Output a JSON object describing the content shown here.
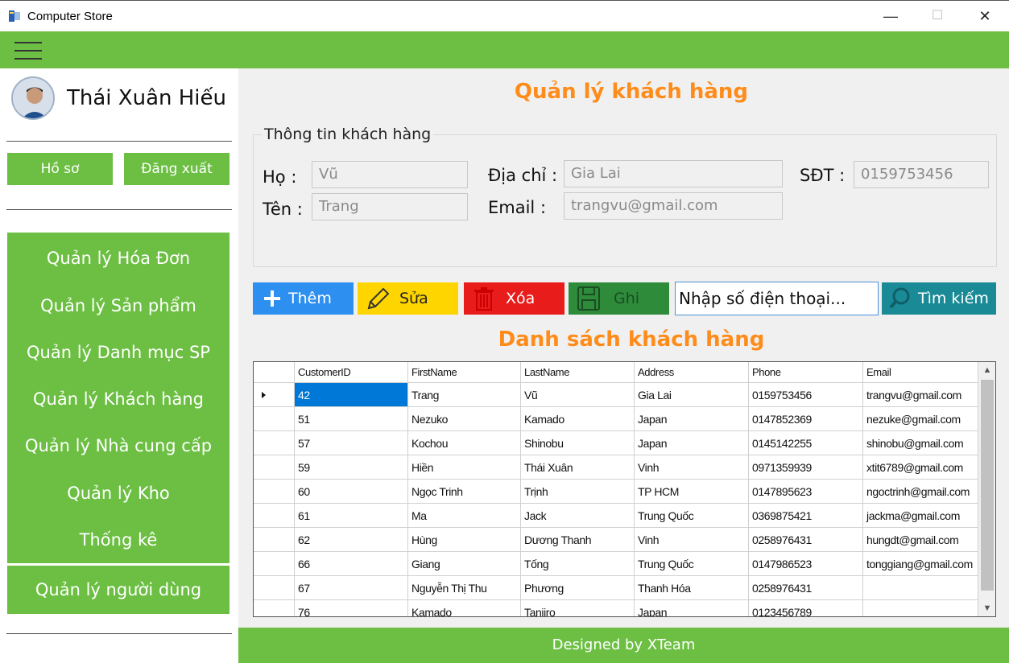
{
  "window": {
    "title": "Computer Store",
    "minimize": "—",
    "maximize": "☐",
    "close": "✕"
  },
  "sidebar": {
    "user_name": "Thái Xuân Hiếu",
    "profile_btn": "Hồ sơ",
    "logout_btn": "Đăng xuất",
    "nav": [
      "Quản lý Hóa Đơn",
      "Quản lý Sản phẩm",
      "Quản lý Danh mục SP",
      "Quản lý Khách hàng",
      "Quản lý Nhà cung cấp",
      "Quản lý Kho",
      "Thống kê"
    ],
    "user_mgmt": "Quản lý người dùng"
  },
  "main": {
    "title": "Quản lý khách hàng",
    "group_title": "Thông tin khách hàng",
    "labels": {
      "ho": "Họ :",
      "ten": "Tên :",
      "diachi": "Địa chỉ :",
      "email": "Email :",
      "sdt": "SĐT :"
    },
    "values": {
      "ho": "Vũ",
      "ten": "Trang",
      "diachi": "Gia Lai",
      "email": "trangvu@gmail.com",
      "sdt": "0159753456"
    },
    "buttons": {
      "add": "Thêm",
      "edit": "Sửa",
      "delete": "Xóa",
      "save": "Ghi",
      "search": "Tìm kiếm"
    },
    "search_value": "Nhập số điện thoại...",
    "list_title": "Danh sách khách hàng"
  },
  "colors": {
    "green": "#6cbf43",
    "orange": "#ff8c1a",
    "add": "#2d8ff0",
    "edit": "#ffd500",
    "delete": "#e91c1c",
    "save": "#2e8b3a",
    "search": "#1a8a96"
  },
  "grid": {
    "columns": [
      "CustomerID",
      "FirstName",
      "LastName",
      "Address",
      "Phone",
      "Email"
    ],
    "rows": [
      [
        "42",
        "Trang",
        "Vũ",
        "Gia Lai",
        "0159753456",
        "trangvu@gmail.com"
      ],
      [
        "51",
        "Nezuko",
        "Kamado",
        "Japan",
        "0147852369",
        "nezuke@gmail.com"
      ],
      [
        "57",
        "Kochou",
        "Shinobu",
        "Japan",
        "0145142255",
        "shinobu@gmail.com"
      ],
      [
        "59",
        "Hiền",
        "Thái Xuân",
        "Vinh",
        "0971359939",
        "xtit6789@gmail.com"
      ],
      [
        "60",
        "Ngọc Trinh",
        "Trịnh",
        "TP HCM",
        "0147895623",
        "ngoctrinh@gmail.com"
      ],
      [
        "61",
        "Ma",
        "Jack",
        "Trung Quốc",
        "0369875421",
        "jackma@gmail.com"
      ],
      [
        "62",
        "Hùng",
        "Dương Thanh",
        "Vinh",
        "0258976431",
        "hungdt@gmail.com"
      ],
      [
        "66",
        "Giang",
        "Tống",
        "Trung Quốc",
        "0147986523",
        "tonggiang@gmail.com"
      ],
      [
        "67",
        "Nguyễn Thị Thu",
        "Phương",
        "Thanh Hóa",
        "0258976431",
        ""
      ],
      [
        "76",
        "Kamado",
        "Tanjiro",
        "Japan",
        "0123456789",
        ""
      ]
    ]
  },
  "footer": "Designed by XTeam"
}
